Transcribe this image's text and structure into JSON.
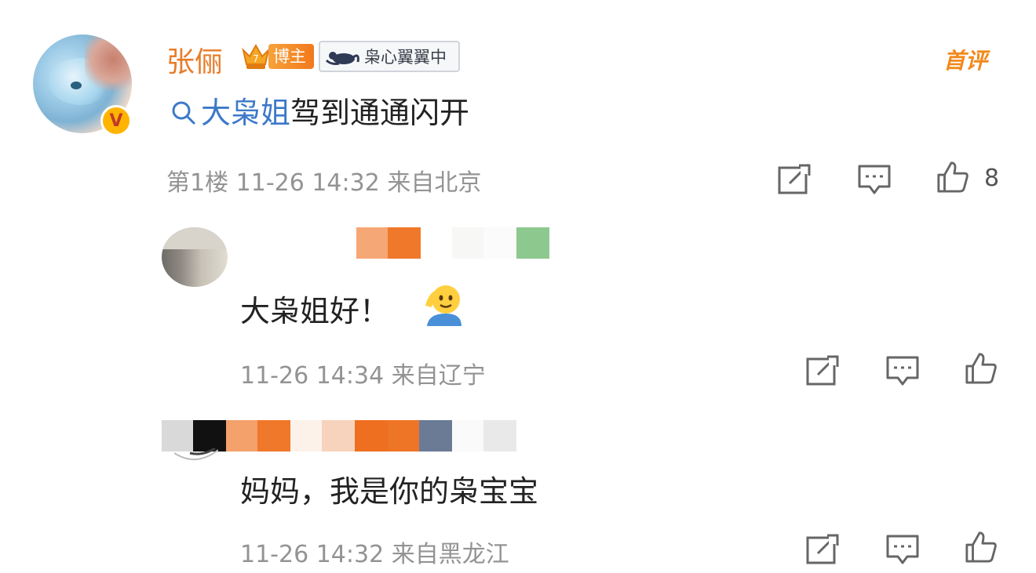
{
  "main_comment": {
    "username": "张俪",
    "blogger_badge": "博主",
    "crown_level": "7",
    "fan_badge": "枭心翼翼中",
    "first_comment_tag": "首评",
    "verified_mark": "V",
    "topic": "大枭姐",
    "text": "驾到通通闪开",
    "floor": "第1楼",
    "time": "11-26 14:32",
    "location": "来自北京",
    "like_count": "8"
  },
  "replies": [
    {
      "text": "大枭姐好！",
      "emoji": "salute-emoji",
      "time": "11-26 14:34",
      "location": "来自辽宁",
      "name_mosaic": [
        "#ffffff",
        "#ffffff",
        "#ffffff",
        "#ffffff",
        "#ffffff",
        "#ffffff",
        "#f6a776",
        "#f0782a",
        "#ffffff",
        "#ffffff",
        "#f7f7f5",
        "#fbfbfb",
        "#8dc88f"
      ]
    },
    {
      "text": "妈妈，我是你的枭宝宝",
      "time": "11-26 14:32",
      "location": "来自黑龙江",
      "name_mosaic": [
        "#d9d9d9",
        "#111111",
        "#f4a16c",
        "#f0782a",
        "#fdf2ea",
        "#f7d3bd",
        "#ee6f1f",
        "#ef7526",
        "#6b7b96",
        "#fafafa",
        "#e9e9e9"
      ]
    }
  ],
  "colors": {
    "username": "#e87c2a",
    "topic_link": "#3c79c9",
    "meta_text": "#939393",
    "first_comment": "#f2891b"
  }
}
